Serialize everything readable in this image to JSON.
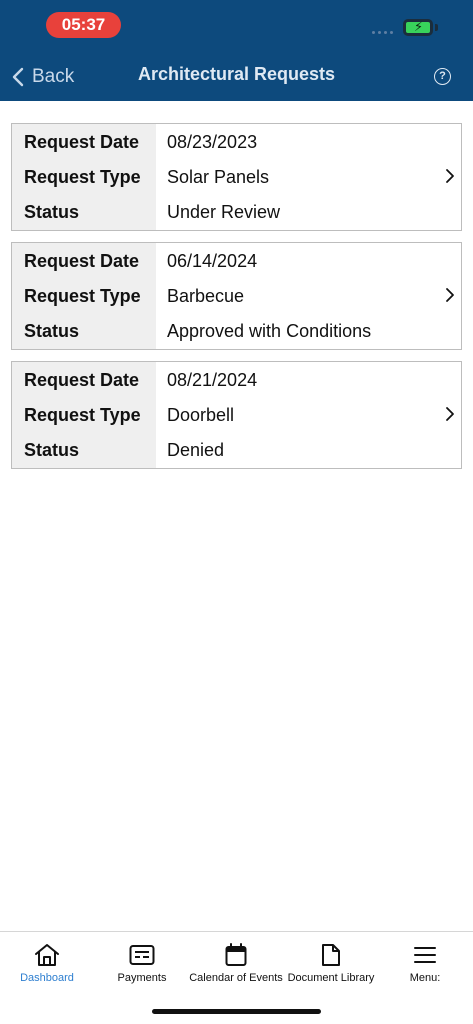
{
  "status_bar": {
    "time": "05:37"
  },
  "nav": {
    "back_label": "Back",
    "title": "Architectural Requests",
    "help_symbol": "?"
  },
  "requests": [
    {
      "date_label": "Request Date",
      "date": "08/23/2023",
      "type_label": "Request Type",
      "type": "Solar Panels",
      "status_label": "Status",
      "status": "Under Review"
    },
    {
      "date_label": "Request Date",
      "date": "06/14/2024",
      "type_label": "Request Type",
      "type": "Barbecue",
      "status_label": "Status",
      "status": "Approved with Conditions"
    },
    {
      "date_label": "Request Date",
      "date": "08/21/2024",
      "type_label": "Request Type",
      "type": "Doorbell",
      "status_label": "Status",
      "status": "Denied"
    }
  ],
  "tabs": [
    {
      "label": "Dashboard",
      "icon": "home-icon",
      "active": true
    },
    {
      "label": "Payments",
      "icon": "payment-card-icon",
      "active": false
    },
    {
      "label": "Calendar of Events",
      "icon": "calendar-icon",
      "active": false
    },
    {
      "label": "Document Library",
      "icon": "document-icon",
      "active": false
    },
    {
      "label": "Menu:",
      "icon": "menu-icon",
      "active": false
    }
  ],
  "colors": {
    "nav_bg": "#0d4a7d",
    "accent": "#2e7fd0",
    "time_pill": "#e8413b",
    "label_bg": "#efefef"
  }
}
